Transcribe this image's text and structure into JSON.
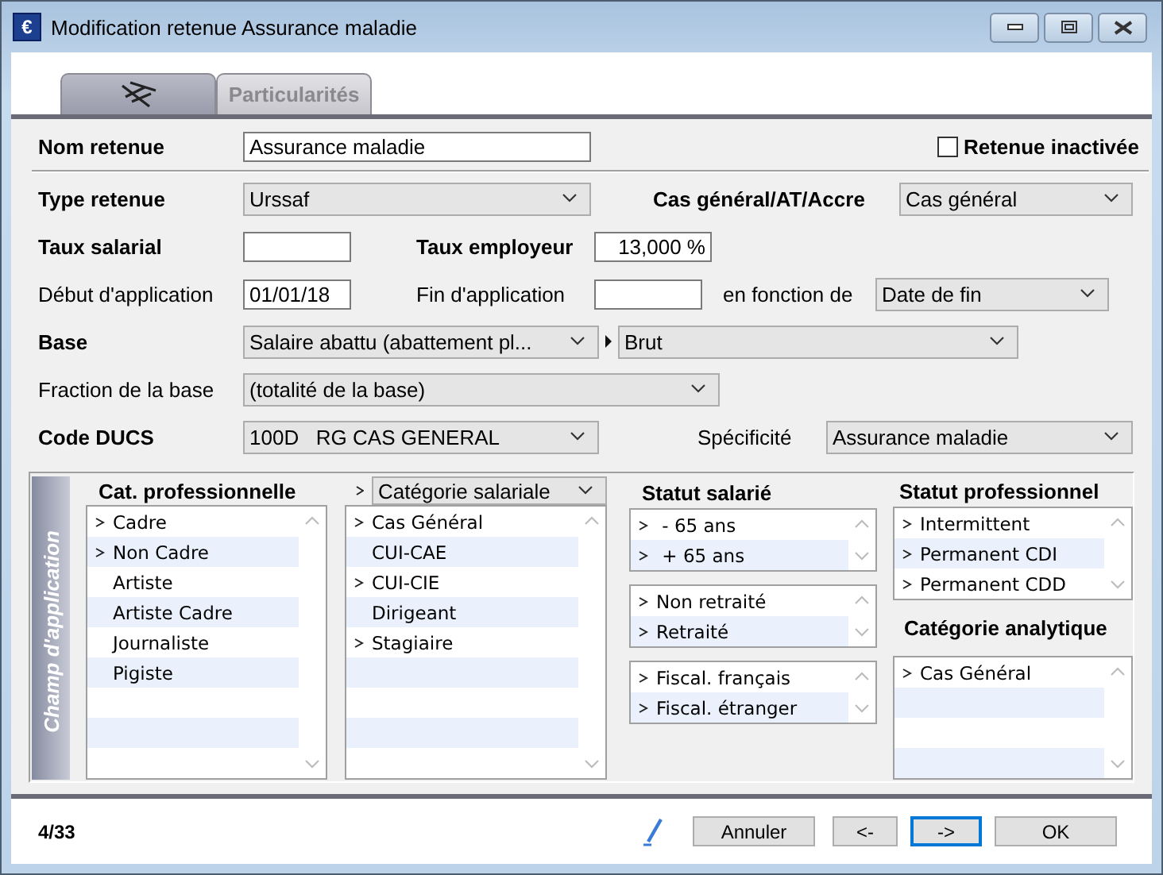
{
  "window": {
    "title": "Modification retenue Assurance maladie",
    "icon_glyph": "€"
  },
  "tabs": [
    {
      "kind": "icon",
      "selected": true
    },
    {
      "kind": "text",
      "label": "Particularités",
      "selected": false
    }
  ],
  "nom_retenue": {
    "label": "Nom retenue",
    "value": "Assurance maladie"
  },
  "retenue_inactive": {
    "label": "Retenue inactivée",
    "checked": false
  },
  "type_retenue": {
    "label": "Type retenue",
    "value": "Urssaf"
  },
  "cas_general": {
    "label": "Cas général/AT/Accre",
    "value": "Cas général"
  },
  "taux_salarial": {
    "label": "Taux salarial"
  },
  "taux_employeur": {
    "label": "Taux employeur",
    "value": "13,000 %"
  },
  "debut_application": {
    "label": "Début d'application",
    "value": "01/01/18"
  },
  "fin_application": {
    "label": "Fin d'application"
  },
  "en_fonction_de": {
    "label": "en fonction de",
    "value": "Date de fin"
  },
  "base": {
    "label": "Base",
    "value": "Salaire abattu (abattement pl...",
    "sub_value": "Brut"
  },
  "fraction_base": {
    "label": "Fraction de la base",
    "value": "(totalité de la base)"
  },
  "code_ducs": {
    "label": "Code DUCS",
    "value": "100D   RG CAS GENERAL"
  },
  "specificite": {
    "label": "Spécificité",
    "value": "Assurance maladie"
  },
  "champ_application": {
    "title": "Champ d'application",
    "cat_professionnelle": {
      "title": "Cat. professionnelle",
      "items": [
        {
          "label": "Cadre",
          "selected": true
        },
        {
          "label": "Non Cadre",
          "selected": true
        },
        {
          "label": "Artiste",
          "selected": false
        },
        {
          "label": "Artiste Cadre",
          "selected": false
        },
        {
          "label": "Journaliste",
          "selected": false
        },
        {
          "label": "Pigiste",
          "selected": false
        }
      ]
    },
    "categorie_salariale": {
      "value": "Catégorie salariale",
      "items": [
        {
          "label": "Cas Général",
          "selected": true
        },
        {
          "label": "CUI-CAE",
          "selected": false
        },
        {
          "label": "CUI-CIE",
          "selected": true
        },
        {
          "label": "Dirigeant",
          "selected": false
        },
        {
          "label": "Stagiaire",
          "selected": true
        }
      ]
    },
    "statut_salarie": {
      "title": "Statut salarié",
      "lists": [
        [
          {
            "label": " - 65 ans",
            "selected": true
          },
          {
            "label": " + 65 ans",
            "selected": true
          }
        ],
        [
          {
            "label": "Non retraité",
            "selected": true
          },
          {
            "label": "Retraité",
            "selected": true
          }
        ],
        [
          {
            "label": "Fiscal. français",
            "selected": true
          },
          {
            "label": "Fiscal. étranger",
            "selected": true
          }
        ]
      ]
    },
    "statut_professionnel": {
      "title": "Statut professionnel",
      "items": [
        {
          "label": "Intermittent",
          "selected": true
        },
        {
          "label": "Permanent CDI",
          "selected": true
        },
        {
          "label": "Permanent CDD",
          "selected": true
        }
      ]
    },
    "categorie_analytique": {
      "title": "Catégorie analytique",
      "items": [
        {
          "label": "Cas Général",
          "selected": true
        }
      ]
    }
  },
  "footer": {
    "record": "4/33",
    "buttons": [
      {
        "label": "Annuler",
        "focused": false
      },
      {
        "label": "<-",
        "focused": false
      },
      {
        "label": "->",
        "focused": true
      },
      {
        "label": "OK",
        "focused": false
      }
    ]
  }
}
